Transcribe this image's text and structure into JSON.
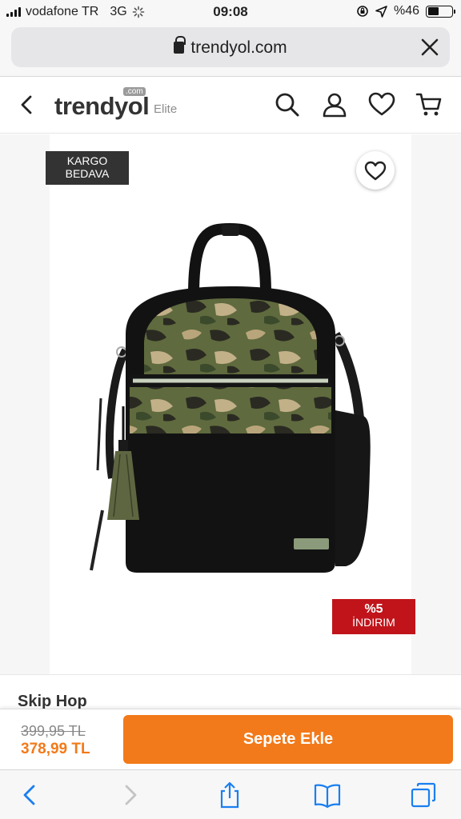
{
  "status": {
    "carrier": "vodafone TR",
    "network": "3G",
    "time": "09:08",
    "battery": "%46",
    "battery_level": 0.46
  },
  "browser": {
    "url": "trendyol.com"
  },
  "header": {
    "logo_main": "trendyol",
    "logo_com": ".com",
    "logo_sub": "Elite",
    "icons": [
      "back-icon",
      "search-icon",
      "account-icon",
      "heart-icon",
      "cart-icon"
    ]
  },
  "product": {
    "cargo_badge_line1": "KARGO",
    "cargo_badge_line2": "BEDAVA",
    "discount_pct": "%5",
    "discount_label": "İNDIRIM",
    "brand": "Skip Hop"
  },
  "buy_bar": {
    "old_price": "399,95 TL",
    "new_price": "378,99 TL",
    "add_to_cart": "Sepete Ekle"
  },
  "toolbar": {
    "icons": [
      "back-icon",
      "forward-icon",
      "share-icon",
      "bookmarks-icon",
      "tabs-icon"
    ]
  },
  "colors": {
    "accent": "#f27a1a",
    "discount": "#c0141a",
    "badge": "#333333"
  }
}
